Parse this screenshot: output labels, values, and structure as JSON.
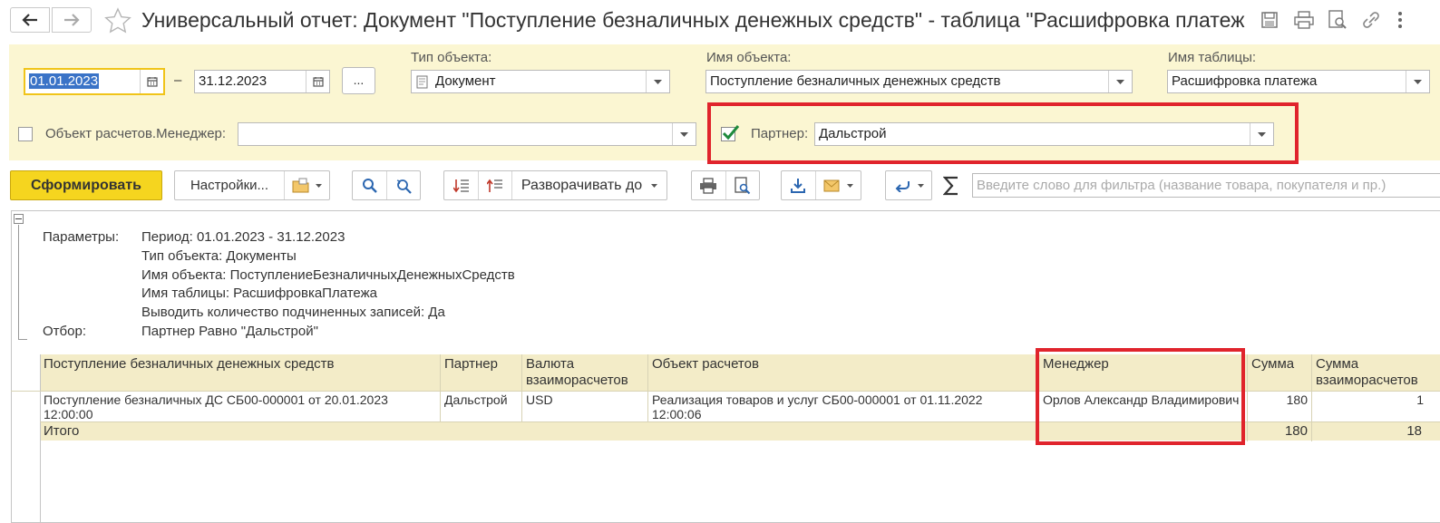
{
  "window": {
    "title": "Универсальный отчет: Документ \"Поступление безналичных денежных средств\" - таблица \"Расшифровка платеж",
    "icons": [
      "arrow-left-icon",
      "arrow-right-icon",
      "star-icon",
      "save-icon",
      "print-icon",
      "preview-icon",
      "link-icon",
      "more-icon"
    ]
  },
  "filters": {
    "date_from": "01.01.2023",
    "dash": "–",
    "date_to": "31.12.2023",
    "period_button": "...",
    "object_type_label": "Тип объекта:",
    "object_type_value": "Документ",
    "object_name_label": "Имя объекта:",
    "object_name_value": "Поступление безналичных денежных средств",
    "table_name_label": "Имя таблицы:",
    "table_name_value": "Расшифровка платежа",
    "manager_label": "Объект расчетов.Менеджер:",
    "manager_value": "",
    "manager_checked": false,
    "partner_label": "Партнер:",
    "partner_value": "Дальстрой",
    "partner_checked": true
  },
  "toolbar": {
    "generate": "Сформировать",
    "settings": "Настройки...",
    "expand_to": "Разворачивать до",
    "search_placeholder": "Введите слово для фильтра (название товара, покупателя и пр.)"
  },
  "report": {
    "params_label": "Параметры:",
    "params": [
      "Период: 01.01.2023 - 31.12.2023",
      "Тип объекта: Документы",
      "Имя объекта: ПоступлениеБезналичныхДенежныхСредств",
      "Имя таблицы: РасшифровкаПлатежа",
      "Выводить количество подчиненных записей: Да"
    ],
    "filter_label": "Отбор:",
    "filter_value": "Партнер Равно \"Дальстрой\"",
    "columns": [
      "Поступление безналичных денежных средств",
      "Партнер",
      "Валюта взаиморасчетов",
      "Объект расчетов",
      "Менеджер",
      "Сумма",
      "Сумма взаиморасчетов"
    ],
    "row": {
      "doc": "Поступление безналичных ДС СБ00-000001 от 20.01.2023 12:00:00",
      "partner": "Дальстрой",
      "currency": "USD",
      "object": "Реализация товаров и услуг СБ00-000001 от 01.11.2022 12:00:06",
      "manager": "Орлов Александр Владимирович",
      "sum": "180",
      "sum_settle": "1"
    },
    "total": {
      "label": "Итого",
      "sum": "180",
      "sum_settle": "18"
    }
  },
  "colors": {
    "panel_bg": "#fbf6d2",
    "header_bg": "#f3ecc8",
    "accent": "#f5d51f",
    "highlight": "#e0242c",
    "check": "#1e8a3c"
  }
}
